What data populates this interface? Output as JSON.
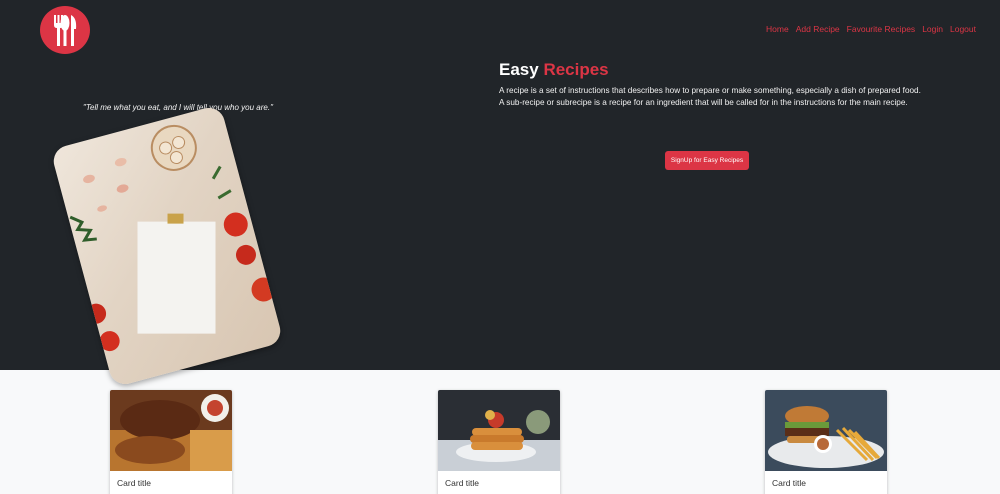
{
  "brand": {
    "logo_icon": "chef-hat-utensils-icon",
    "color": "#dc3545"
  },
  "nav": {
    "items": [
      {
        "label": "Home"
      },
      {
        "label": "Add Recipe"
      },
      {
        "label": "Favourite Recipes"
      },
      {
        "label": "Login"
      },
      {
        "label": "Logout"
      }
    ]
  },
  "hero": {
    "quote": "\"Tell me what you eat, and I will tell you who you are.\"",
    "title_part1": "Easy",
    "title_part2": "Recipes",
    "description": "A recipe is a set of instructions that describes how to prepare or make something, especially a dish of prepared food. A sub-recipe or subrecipe is a recipe for an ingredient that will be called for in the instructions for the main recipe.",
    "signup_label": "SignUp for Easy Recipes",
    "background": "#212529"
  },
  "cards": [
    {
      "title": "Card title",
      "image": "biryani-chicken-photo"
    },
    {
      "title": "Card title",
      "image": "pancake-stack-photo"
    },
    {
      "title": "Card title",
      "image": "burger-fries-photo"
    }
  ]
}
